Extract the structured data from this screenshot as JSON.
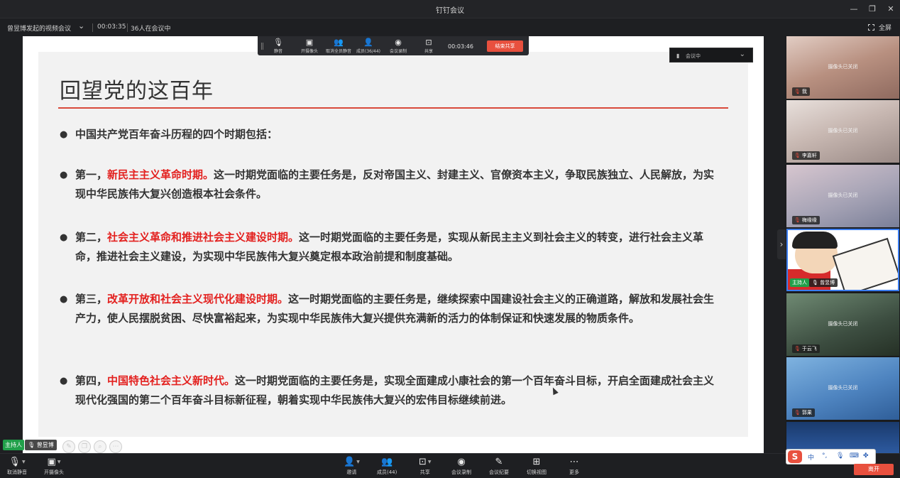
{
  "window": {
    "title": "钉钉会议",
    "controls": {
      "minimize": "—",
      "restore": "❐",
      "close": "✕"
    }
  },
  "infobar": {
    "meeting_name": "曾昱博发起的视频会议",
    "timer": "00:03:35",
    "participants": "36人在会议中",
    "fullscreen_label": "全屏"
  },
  "share_toolbar": {
    "items": [
      {
        "icon": "microphone-icon",
        "glyph": "🎙",
        "label": "静音"
      },
      {
        "icon": "camera-off-icon",
        "glyph": "▣",
        "label": "开摄像头"
      },
      {
        "icon": "mute-all-icon",
        "glyph": "👥",
        "label": "取消全员静音"
      },
      {
        "icon": "members-icon",
        "glyph": "👤",
        "label": "成员(36/44)"
      },
      {
        "icon": "record-icon",
        "glyph": "◉",
        "label": "会议录制"
      },
      {
        "icon": "share-screen-icon",
        "glyph": "⊡",
        "label": "共享"
      }
    ],
    "timer": "00:03:46",
    "end_share_label": "结束共享"
  },
  "meeting_dropdown": {
    "label": "会议中"
  },
  "slide": {
    "title": "回望党的这百年",
    "bullets": [
      {
        "lead": "中国共产党百年奋斗历程的四个时期包括：",
        "highlight": "",
        "body": ""
      },
      {
        "lead": "第一，",
        "highlight": "新民主主义革命时期。",
        "body": "这一时期党面临的主要任务是，反对帝国主义、封建主义、官僚资本主义，争取民族独立、人民解放，为实现中华民族伟大复兴创造根本社会条件。"
      },
      {
        "lead": "第二，",
        "highlight": "社会主义革命和推进社会主义建设时期。",
        "body": "这一时期党面临的主要任务是，实现从新民主主义到社会主义的转变，进行社会主义革命，推进社会主义建设，为实现中华民族伟大复兴奠定根本政治前提和制度基础。"
      },
      {
        "lead": "第三，",
        "highlight": "改革开放和社会主义现代化建设时期。",
        "body": "这一时期党面临的主要任务是，继续探索中国建设社会主义的正确道路，解放和发展社会生产力，使人民摆脱贫困、尽快富裕起来，为实现中华民族伟大复兴提供充满新的活力的体制保证和快速发展的物质条件。"
      },
      {
        "lead": "第四，",
        "highlight": "中国特色社会主义新时代。",
        "body": "这一时期党面临的主要任务是，实现全面建成小康社会的第一个百年奋斗目标，开启全面建成社会主义现代化强国的第二个百年奋斗目标新征程，朝着实现中华民族伟大复兴的宏伟目标继续前进。"
      }
    ]
  },
  "presenter": {
    "role": "主持人",
    "name": "曾昱博"
  },
  "participants": [
    {
      "camera_status": "摄像头已关闭",
      "name": "我"
    },
    {
      "camera_status": "摄像头已关闭",
      "name": "李嘉轩"
    },
    {
      "camera_status": "摄像头已关闭",
      "name": "梅缘缘"
    },
    {
      "camera_status": "",
      "name": "曾昱博",
      "role": "主持人"
    },
    {
      "camera_status": "摄像头已关闭",
      "name": "于云飞"
    },
    {
      "camera_status": "摄像头已关闭",
      "name": "郭果"
    }
  ],
  "bottom_bar": {
    "left": [
      {
        "icon": "microphone-muted-icon",
        "glyph": "🎙",
        "label": "取消静音"
      },
      {
        "icon": "camera-off-icon",
        "glyph": "▣",
        "label": "开摄像头"
      }
    ],
    "center": [
      {
        "icon": "invite-icon",
        "glyph": "👤",
        "label": "邀请"
      },
      {
        "icon": "members-icon",
        "glyph": "👥",
        "label": "成员(44)"
      },
      {
        "icon": "share-screen-icon",
        "glyph": "⊡",
        "label": "共享"
      },
      {
        "icon": "record-icon",
        "glyph": "◉",
        "label": "会议录制"
      },
      {
        "icon": "minutes-icon",
        "glyph": "✎",
        "label": "会议纪要"
      },
      {
        "icon": "grid-view-icon",
        "glyph": "⊞",
        "label": "切换视图"
      },
      {
        "icon": "more-icon",
        "glyph": "⋯",
        "label": "更多"
      }
    ],
    "leave_label": "离开"
  },
  "ime": {
    "logo": "S",
    "lang": "中",
    "punct": "°,",
    "mic": "🎙",
    "keyboard": "⌨",
    "apps": "✤"
  }
}
